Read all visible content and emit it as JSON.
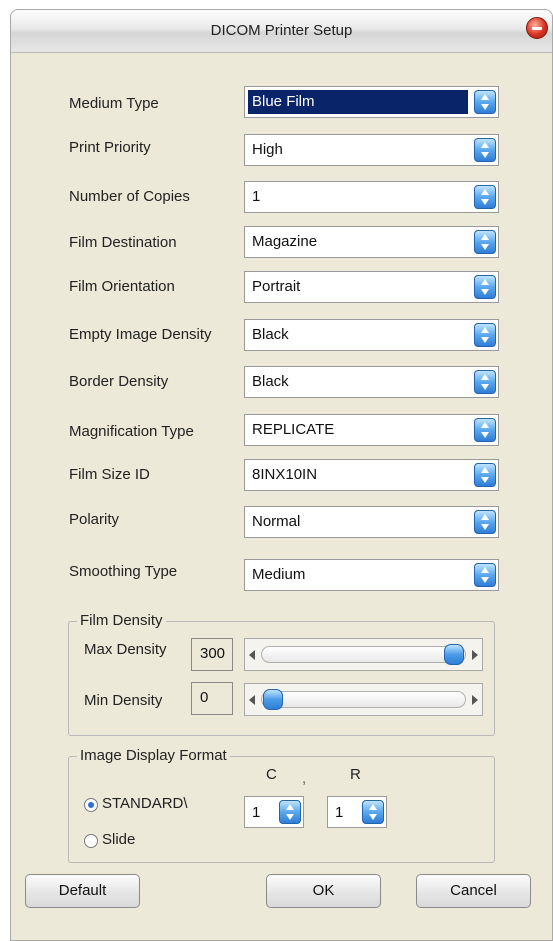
{
  "window": {
    "title": "DICOM Printer Setup"
  },
  "fields": [
    {
      "label": "Medium Type",
      "value": "Blue Film"
    },
    {
      "label": "Print Priority",
      "value": "High"
    },
    {
      "label": "Number of Copies",
      "value": "1"
    },
    {
      "label": "Film Destination",
      "value": "Magazine"
    },
    {
      "label": "Film Orientation",
      "value": "Portrait"
    },
    {
      "label": "Empty Image Density",
      "value": "Black"
    },
    {
      "label": "Border Density",
      "value": "Black"
    },
    {
      "label": "Magnification Type",
      "value": "REPLICATE"
    },
    {
      "label": "Film Size ID",
      "value": "8INX10IN"
    },
    {
      "label": "Polarity",
      "value": "Normal"
    },
    {
      "label": "Smoothing Type",
      "value": "Medium"
    }
  ],
  "film_density": {
    "legend": "Film Density",
    "max": {
      "label": "Max Density",
      "value": "300",
      "slider_fraction": 1.0
    },
    "min": {
      "label": "Min Density",
      "value": "0",
      "slider_fraction": 0.0
    }
  },
  "image_display_format": {
    "legend": "Image Display Format",
    "col_header": "C",
    "col_sep": ",",
    "row_header": "R",
    "options": [
      {
        "label": "STANDARD\\",
        "selected": true
      },
      {
        "label": "Slide",
        "selected": false
      }
    ],
    "columns": "1",
    "rows": "1"
  },
  "buttons": {
    "default": "Default",
    "ok": "OK",
    "cancel": "Cancel"
  },
  "icons": {
    "close": "close-icon",
    "spin": "spin-updown-icon",
    "arrow_left": "arrow-left-icon",
    "arrow_right": "arrow-right-icon"
  }
}
